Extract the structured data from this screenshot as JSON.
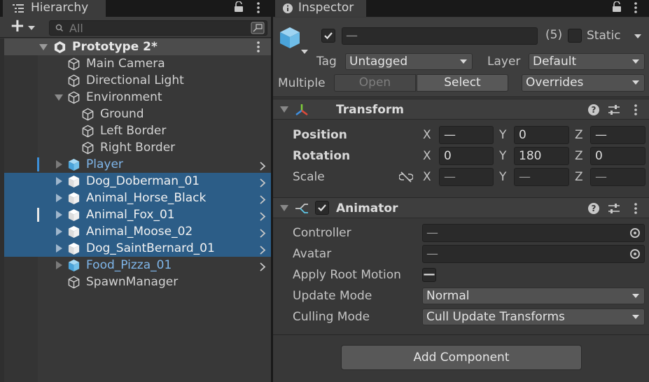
{
  "hierarchy": {
    "tab_title": "Hierarchy",
    "add_label": "+",
    "search_placeholder": "All",
    "scene": "Prototype 2*",
    "rows": [
      {
        "label": "Main Camera",
        "depth": 1,
        "kind": "plain"
      },
      {
        "label": "Directional Light",
        "depth": 1,
        "kind": "plain"
      },
      {
        "label": "Environment",
        "depth": 1,
        "kind": "plain",
        "expanded": true
      },
      {
        "label": "Ground",
        "depth": 2,
        "kind": "plain"
      },
      {
        "label": "Left Border",
        "depth": 2,
        "kind": "plain"
      },
      {
        "label": "Right Border",
        "depth": 2,
        "kind": "plain"
      },
      {
        "label": "Player",
        "depth": 1,
        "kind": "prefab",
        "selected": false
      },
      {
        "label": "Dog_Doberman_01",
        "depth": 1,
        "kind": "prefab",
        "selected": true
      },
      {
        "label": "Animal_Horse_Black",
        "depth": 1,
        "kind": "prefab",
        "selected": true
      },
      {
        "label": "Animal_Fox_01",
        "depth": 1,
        "kind": "prefab",
        "selected": true
      },
      {
        "label": "Animal_Moose_02",
        "depth": 1,
        "kind": "prefab",
        "selected": true
      },
      {
        "label": "Dog_SaintBernard_01",
        "depth": 1,
        "kind": "prefab",
        "selected": true
      },
      {
        "label": "Food_Pizza_01",
        "depth": 1,
        "kind": "prefab",
        "selected": false
      },
      {
        "label": "SpawnManager",
        "depth": 1,
        "kind": "plain"
      }
    ]
  },
  "inspector": {
    "tab_title": "Inspector",
    "name_value": "—",
    "count": "(5)",
    "static_label": "Static",
    "tag_label": "Tag",
    "tag_value": "Untagged",
    "layer_label": "Layer",
    "layer_value": "Default",
    "multiple_label": "Multiple",
    "open_label": "Open",
    "select_label": "Select",
    "overrides_label": "Overrides",
    "transform": {
      "title": "Transform",
      "position_label": "Position",
      "rotation_label": "Rotation",
      "scale_label": "Scale",
      "axes": {
        "x": "X",
        "y": "Y",
        "z": "Z"
      },
      "position": {
        "x": "—",
        "y": "0",
        "z": "—"
      },
      "rotation": {
        "x": "0",
        "y": "180",
        "z": "0"
      },
      "scale": {
        "x": "—",
        "y": "—",
        "z": "—"
      }
    },
    "animator": {
      "title": "Animator",
      "controller_label": "Controller",
      "controller_value": "—",
      "avatar_label": "Avatar",
      "avatar_value": "—",
      "apply_root_motion_label": "Apply Root Motion",
      "apply_root_motion_value": "—",
      "update_mode_label": "Update Mode",
      "update_mode_value": "Normal",
      "culling_mode_label": "Culling Mode",
      "culling_mode_value": "Cull Update Transforms"
    },
    "add_component_label": "Add Component",
    "help_glyph": "?"
  },
  "colors": {
    "selection": "#2c5d87",
    "prefab_text": "#7fb6ea",
    "panel_bg": "#383838",
    "accent_cube": "#63b7e8"
  }
}
